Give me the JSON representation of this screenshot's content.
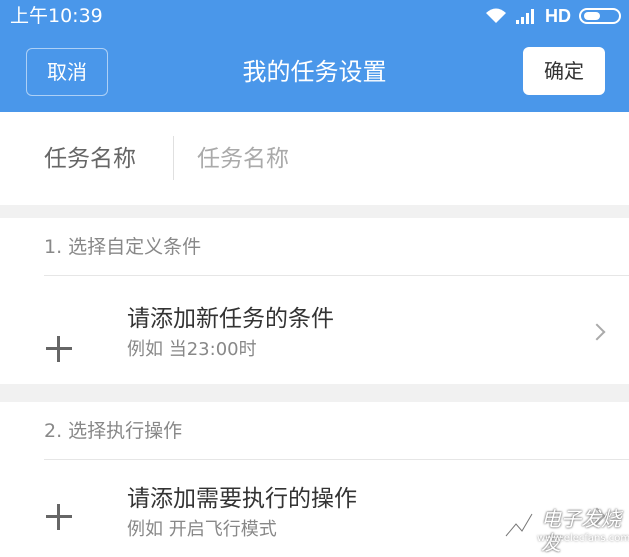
{
  "status_bar": {
    "time": "上午10:39",
    "network": "HD",
    "icons": [
      "wifi-icon",
      "signal-icon",
      "battery-icon"
    ]
  },
  "header": {
    "cancel_label": "取消",
    "title": "我的任务设置",
    "confirm_label": "确定",
    "bg_color": "#4a97ea"
  },
  "task_name": {
    "label": "任务名称",
    "placeholder": "任务名称",
    "value": ""
  },
  "sections": [
    {
      "title": "1. 选择自定义条件",
      "item": {
        "icon": "plus-icon",
        "title": "请添加新任务的条件",
        "subtitle": "例如 当23:00时",
        "trailing_icon": "chevron-right-icon"
      }
    },
    {
      "title": "2. 选择执行操作",
      "item": {
        "icon": "plus-icon",
        "title": "请添加需要执行的操作",
        "subtitle": "例如 开启飞行模式",
        "trailing_icon": "chevron-right-icon"
      }
    }
  ],
  "watermark": {
    "text": "电子发烧友",
    "url": "www.elecfans.com"
  }
}
